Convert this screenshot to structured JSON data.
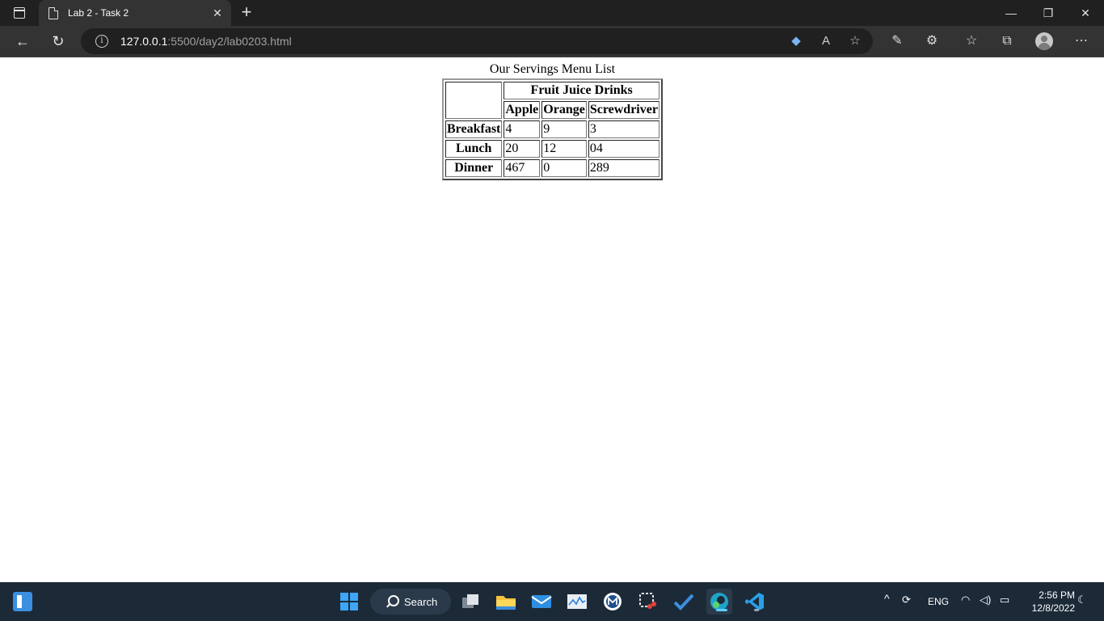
{
  "browser": {
    "tab_title": "Lab 2 - Task 2",
    "url_host": "127.0.0.1",
    "url_rest": ":5500/day2/lab0203.html"
  },
  "page": {
    "caption": "Our Servings Menu List",
    "group_header": "Fruit Juice Drinks",
    "columns": [
      "Apple",
      "Orange",
      "Screwdriver"
    ],
    "rows": [
      {
        "label": "Breakfast",
        "values": [
          "4",
          "9",
          "3"
        ]
      },
      {
        "label": "Lunch",
        "values": [
          "20",
          "12",
          "04"
        ]
      },
      {
        "label": "Dinner",
        "values": [
          "467",
          "0",
          "289"
        ]
      }
    ]
  },
  "taskbar": {
    "search_label": "Search",
    "language": "ENG",
    "time": "2:56 PM",
    "date": "12/8/2022"
  },
  "colors": {
    "tabbar_bg": "#202020",
    "toolbar_bg": "#333333",
    "taskbar_bg": "#1c2a38",
    "accent": "#60cdff"
  }
}
